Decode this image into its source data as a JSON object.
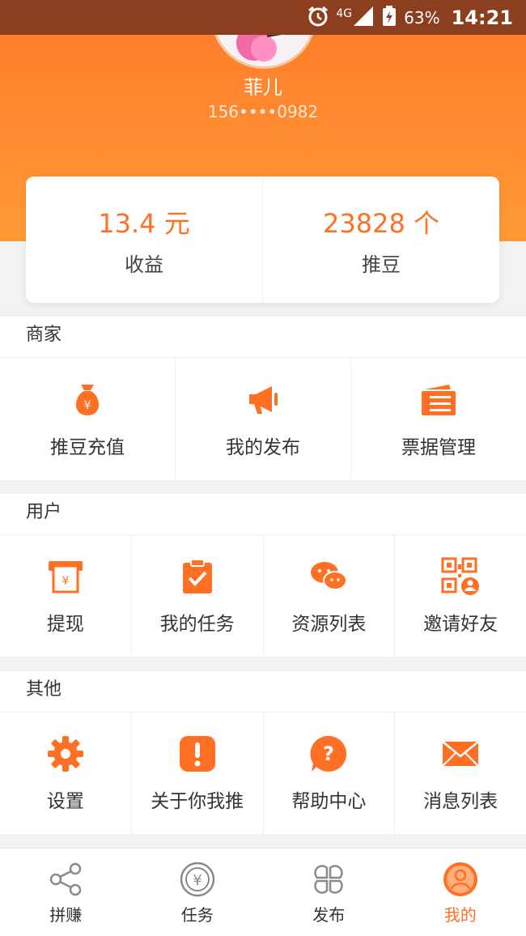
{
  "status_bar": {
    "network": "4G",
    "battery": "63%",
    "time": "14:21"
  },
  "profile": {
    "name": "菲儿",
    "phone": "156••••0982"
  },
  "stats": {
    "income_value": "13.4 元",
    "income_label": "收益",
    "beans_value": "23828 个",
    "beans_label": "推豆"
  },
  "sections": {
    "merchant": {
      "title": "商家",
      "items": [
        "推豆充值",
        "我的发布",
        "票据管理"
      ]
    },
    "user": {
      "title": "用户",
      "items": [
        "提现",
        "我的任务",
        "资源列表",
        "邀请好友"
      ]
    },
    "other": {
      "title": "其他",
      "items": [
        "设置",
        "关于你我推",
        "帮助中心",
        "消息列表"
      ]
    }
  },
  "tabbar": {
    "items": [
      "拼赚",
      "任务",
      "发布",
      "我的"
    ],
    "active": "我的"
  },
  "colors": {
    "accent": "#ff6f24",
    "status_bar": "#8c3f1e",
    "inactive_icon": "#8a8a8a"
  }
}
